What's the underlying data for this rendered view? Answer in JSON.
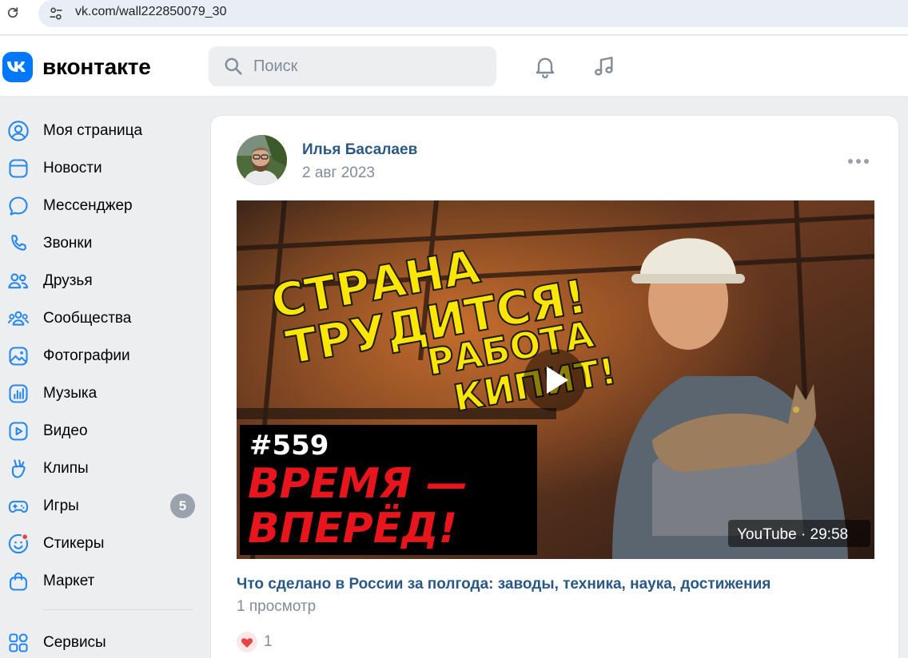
{
  "browser": {
    "url": "vk.com/wall222850079_30",
    "reload_icon": "reload-icon",
    "site_info_icon": "tune-icon"
  },
  "header": {
    "logo_text": "вконтакте",
    "search_placeholder": "Поиск",
    "notifications_icon": "bell-icon",
    "music_icon": "music-note-icon"
  },
  "sidebar": {
    "items": [
      {
        "label": "Моя страница",
        "icon": "user-circle-icon"
      },
      {
        "label": "Новости",
        "icon": "news-icon"
      },
      {
        "label": "Мессенджер",
        "icon": "chat-bubble-icon"
      },
      {
        "label": "Звонки",
        "icon": "phone-icon"
      },
      {
        "label": "Друзья",
        "icon": "friends-icon"
      },
      {
        "label": "Сообщества",
        "icon": "communities-icon"
      },
      {
        "label": "Фотографии",
        "icon": "photo-icon"
      },
      {
        "label": "Музыка",
        "icon": "music-icon"
      },
      {
        "label": "Видео",
        "icon": "video-icon"
      },
      {
        "label": "Клипы",
        "icon": "clips-icon"
      },
      {
        "label": "Игры",
        "icon": "gamepad-icon",
        "badge": "5"
      },
      {
        "label": "Стикеры",
        "icon": "sticker-icon"
      },
      {
        "label": "Маркет",
        "icon": "shopping-bag-icon"
      },
      {
        "label": "Сервисы",
        "icon": "services-grid-icon"
      }
    ]
  },
  "post": {
    "author": "Илья Басалаев",
    "date": "2 авг 2023",
    "video": {
      "thumb_line1": "СТРАНА",
      "thumb_line2": "ТРУДИТСЯ!",
      "thumb_line3": "РАБОТА",
      "thumb_line4": "КИПИТ!",
      "thumb_number": "#559",
      "thumb_red1": "ВРЕМЯ —",
      "thumb_red2": "ВПЕРЁД!",
      "source_duration": "YouTube · 29:58"
    },
    "title": "Что сделано в России за полгода: заводы, техника, наука, достижения",
    "views": "1 просмотр",
    "likes": "1"
  },
  "colors": {
    "accent": "#0077ff",
    "link": "#2a5885",
    "muted": "#818c99",
    "badge": "#99a2ad",
    "like_red": "#e64646",
    "thumb_yellow": "#ffe600",
    "thumb_red": "#e8161c"
  }
}
